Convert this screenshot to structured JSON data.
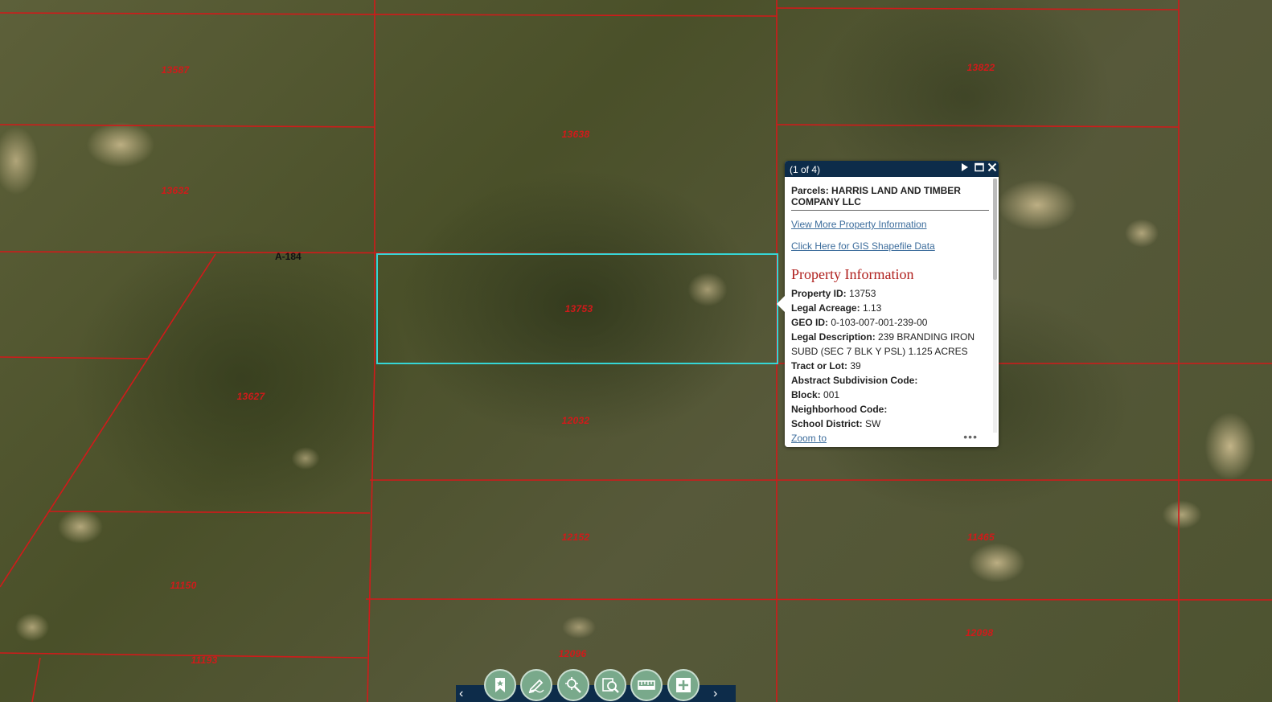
{
  "map": {
    "parcel_labels": [
      "13587",
      "13632",
      "13638",
      "13822",
      "13753",
      "13627",
      "12032",
      "12152",
      "11150",
      "11193",
      "11465",
      "12098",
      "12096"
    ],
    "abstract_label": "A-184",
    "colors": {
      "parcel_line": "#d11a1a",
      "highlight": "#35d6d6",
      "label": "#d11a1a"
    }
  },
  "popup": {
    "count": "(1 of 4)",
    "title": "Parcels: HARRIS LAND AND TIMBER COMPANY LLC",
    "link_more": "View More Property Information",
    "link_gis": "Click Here for GIS Shapefile Data",
    "section_title": "Property Information",
    "fields": [
      {
        "label": "Property ID:",
        "value": "13753"
      },
      {
        "label": "Legal Acreage:",
        "value": "1.13"
      },
      {
        "label": "GEO ID:",
        "value": "0-103-007-001-239-00"
      },
      {
        "label": "Legal Description:",
        "value": "239 BRANDING IRON SUBD (SEC 7 BLK Y PSL) 1.125 ACRES"
      },
      {
        "label": "Tract or Lot:",
        "value": "39"
      },
      {
        "label": "Abstract Subdivision Code:",
        "value": ""
      },
      {
        "label": "Block:",
        "value": "001"
      },
      {
        "label": "Neighborhood Code:",
        "value": ""
      },
      {
        "label": "School District:",
        "value": "SW"
      }
    ],
    "zoom_to": "Zoom to",
    "more": "•••",
    "icons": [
      "next-icon",
      "maximize-icon",
      "close-icon"
    ]
  },
  "toolbar": {
    "prev": "‹",
    "next": "›",
    "tools": [
      "bookmark-icon",
      "draw-icon",
      "select-icon",
      "search-icon",
      "measure-icon",
      "add-icon"
    ]
  }
}
